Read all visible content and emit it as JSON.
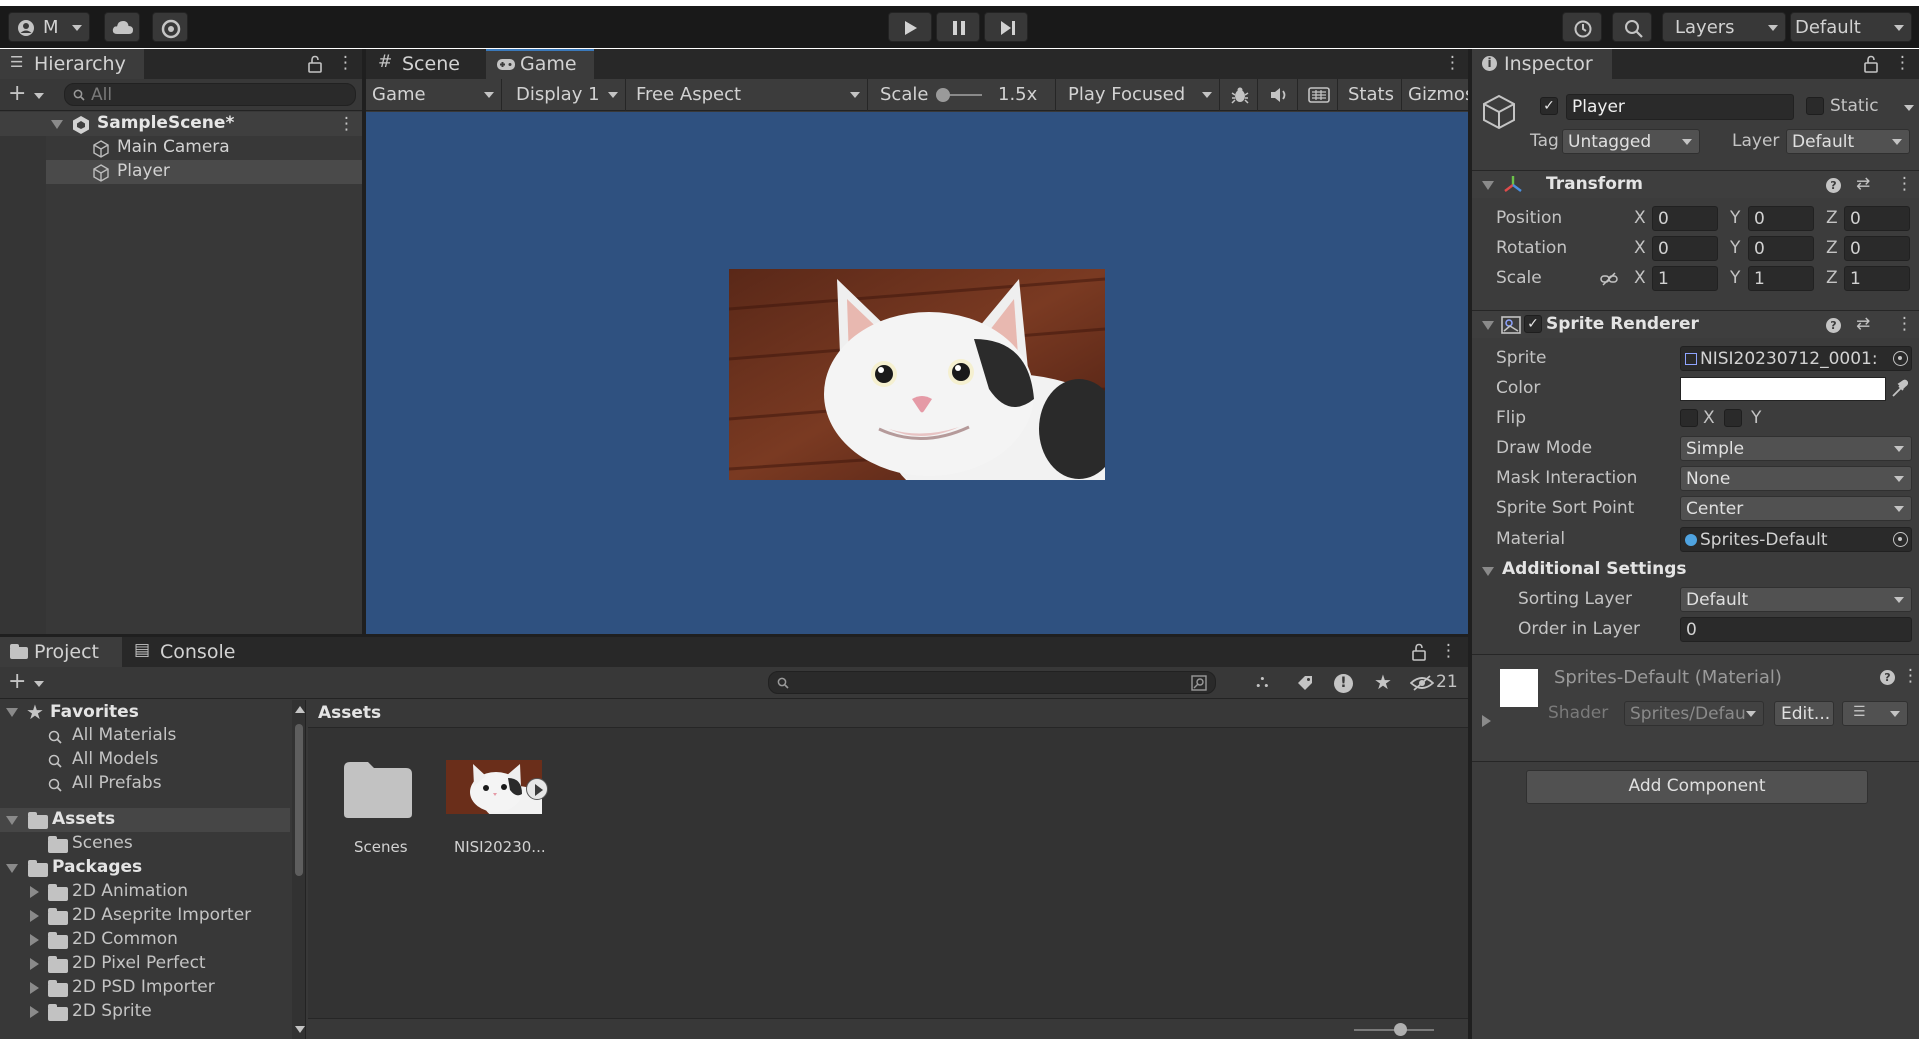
{
  "toolbar": {
    "account": "M",
    "layers": "Layers",
    "layout": "Default"
  },
  "hierarchy": {
    "tab": "Hierarchy",
    "search_placeholder": "All",
    "scene": "SampleScene*",
    "items": [
      "Main Camera",
      "Player"
    ]
  },
  "game_view": {
    "tabs": [
      "Scene",
      "Game"
    ],
    "view_mode": "Game",
    "display": "Display 1",
    "aspect": "Free Aspect",
    "scale_label": "Scale",
    "scale_value": "1.5x",
    "play_mode": "Play Focused",
    "stats": "Stats",
    "gizmos": "Gizmos",
    "background": "#2f5180"
  },
  "inspector": {
    "tab": "Inspector",
    "object_name": "Player",
    "static_label": "Static",
    "tag_label": "Tag",
    "tag_value": "Untagged",
    "layer_label": "Layer",
    "layer_value": "Default",
    "transform": {
      "title": "Transform",
      "rows": [
        {
          "label": "Position",
          "x": "0",
          "y": "0",
          "z": "0"
        },
        {
          "label": "Rotation",
          "x": "0",
          "y": "0",
          "z": "0"
        },
        {
          "label": "Scale",
          "x": "1",
          "y": "1",
          "z": "1"
        }
      ],
      "axes": [
        "X",
        "Y",
        "Z"
      ]
    },
    "sprite_renderer": {
      "title": "Sprite Renderer",
      "sprite_label": "Sprite",
      "sprite_value": "NISI20230712_0001:",
      "color_label": "Color",
      "flip_label": "Flip",
      "flip_x": "X",
      "flip_y": "Y",
      "draw_mode_label": "Draw Mode",
      "draw_mode_value": "Simple",
      "mask_label": "Mask Interaction",
      "mask_value": "None",
      "sort_point_label": "Sprite Sort Point",
      "sort_point_value": "Center",
      "material_label": "Material",
      "material_value": "Sprites-Default",
      "additional": "Additional Settings",
      "sorting_layer_label": "Sorting Layer",
      "sorting_layer_value": "Default",
      "order_label": "Order in Layer",
      "order_value": "0"
    },
    "material": {
      "title": "Sprites-Default (Material)",
      "shader_label": "Shader",
      "shader_value": "Sprites/Defau",
      "edit": "Edit..."
    },
    "add_component": "Add Component"
  },
  "project": {
    "tabs": [
      "Project",
      "Console"
    ],
    "hidden_count": "21",
    "favorites": {
      "title": "Favorites",
      "items": [
        "All Materials",
        "All Models",
        "All Prefabs"
      ]
    },
    "assets_title": "Assets",
    "assets_children": [
      "Scenes"
    ],
    "packages_title": "Packages",
    "packages": [
      "2D Animation",
      "2D Aseprite Importer",
      "2D Common",
      "2D Pixel Perfect",
      "2D PSD Importer",
      "2D Sprite"
    ],
    "breadcrumb": "Assets",
    "grid": [
      "Scenes",
      "NISI20230..."
    ]
  }
}
